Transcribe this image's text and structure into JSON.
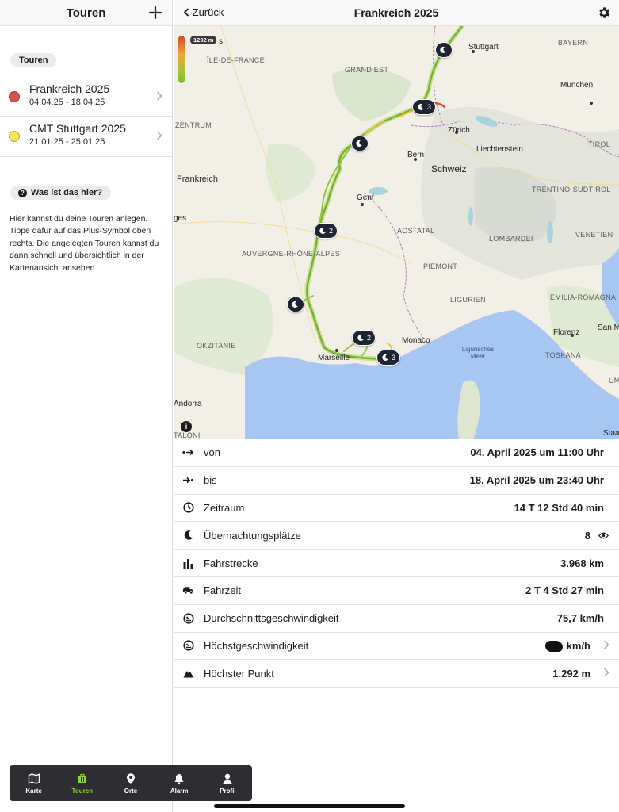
{
  "left": {
    "title": "Touren",
    "section_label": "Touren",
    "tours": [
      {
        "name": "Frankreich 2025",
        "dates": "04.04.25 - 18.04.25",
        "color": "#d9534f"
      },
      {
        "name": "CMT Stuttgart 2025",
        "dates": "21.01.25 - 25.01.25",
        "color": "#f7e55a"
      }
    ],
    "help_label": "Was ist das hier?",
    "help_text": "Hier kannst du deine Touren anlegen. Tippe dafür auf das Plus-Symbol oben rechts. Die angelegten Touren kannst du dann schnell und übersichtlich in der Kartenansicht ansehen."
  },
  "header": {
    "back_label": "Zurück",
    "title": "Frankreich 2025"
  },
  "map": {
    "elevation_badge": "1292 m",
    "regions": [
      "ÎLE-DE-FRANCE",
      "GRAND EST",
      "BAYERN",
      "ZENTRUM",
      "TIROL",
      "TRENTINO-SÜDTIROL",
      "AUVERGNE-RHÔNE-ALPES",
      "AOSTATAL",
      "LOMBARDEI",
      "VENETIEN",
      "PIEMONT",
      "EMILIA-ROMAGNA",
      "LIGURIEN",
      "OKZITANIE",
      "TOSKANA",
      "UMBR"
    ],
    "cities": [
      "Stuttgart",
      "München",
      "Zürich",
      "Liechtenstein",
      "Bern",
      "Schweiz",
      "Frankreich",
      "Genf",
      "Monaco",
      "Marseille",
      "Florenz",
      "San Ma",
      "Andorra",
      "Staa",
      "ges",
      "s",
      "TALONI"
    ],
    "sea": "Ligurisches Meer",
    "info_icon": "info-icon",
    "pins": [
      {
        "count": ""
      },
      {
        "count": "3"
      },
      {
        "count": ""
      },
      {
        "count": "2"
      },
      {
        "count": ""
      },
      {
        "count": "2"
      },
      {
        "count": "3"
      }
    ]
  },
  "stats": [
    {
      "icon": "arrow-start-icon",
      "label": "von",
      "value": "04. April 2025 um 11:00 Uhr"
    },
    {
      "icon": "arrow-end-icon",
      "label": "bis",
      "value": "18. April 2025 um 23:40 Uhr"
    },
    {
      "icon": "clock-icon",
      "label": "Zeitraum",
      "value": "14 T 12 Std 40 min"
    },
    {
      "icon": "moon-icon",
      "label": "Übernachtungsplätze",
      "value": "8"
    },
    {
      "icon": "bar-chart-icon",
      "label": "Fahrstrecke",
      "value": "3.968 km"
    },
    {
      "icon": "van-icon",
      "label": "Fahrzeit",
      "value": "2 T 4 Std 27 min"
    },
    {
      "icon": "speedometer-icon",
      "label": "Durchschnittsgeschwindigkeit",
      "value": "75,7 km/h"
    },
    {
      "icon": "speedometer-icon",
      "label": "Höchstgeschwindigkeit",
      "value": "km/h"
    },
    {
      "icon": "mountain-icon",
      "label": "Höchster Punkt",
      "value": "1.292 m"
    }
  ],
  "tabbar": {
    "tabs": [
      {
        "label": "Karte",
        "icon": "map-icon"
      },
      {
        "label": "Touren",
        "icon": "suitcase-icon"
      },
      {
        "label": "Orte",
        "icon": "location-pin-icon"
      },
      {
        "label": "Alarm",
        "icon": "bell-icon"
      },
      {
        "label": "Profil",
        "icon": "person-icon"
      }
    ],
    "active_color": "#8fd13b"
  }
}
